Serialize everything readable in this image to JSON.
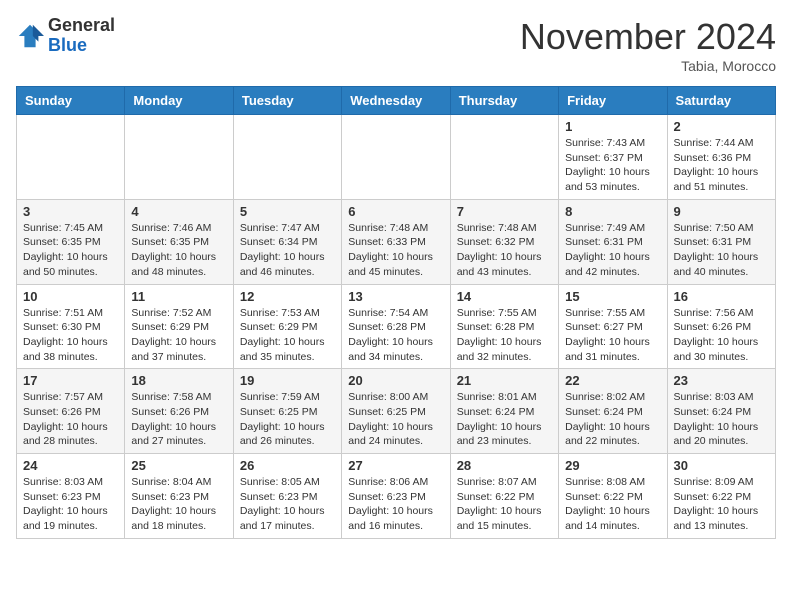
{
  "header": {
    "logo_general": "General",
    "logo_blue": "Blue",
    "month_title": "November 2024",
    "location": "Tabia, Morocco"
  },
  "weekdays": [
    "Sunday",
    "Monday",
    "Tuesday",
    "Wednesday",
    "Thursday",
    "Friday",
    "Saturday"
  ],
  "weeks": [
    [
      {
        "day": "",
        "info": ""
      },
      {
        "day": "",
        "info": ""
      },
      {
        "day": "",
        "info": ""
      },
      {
        "day": "",
        "info": ""
      },
      {
        "day": "",
        "info": ""
      },
      {
        "day": "1",
        "info": "Sunrise: 7:43 AM\nSunset: 6:37 PM\nDaylight: 10 hours and 53 minutes."
      },
      {
        "day": "2",
        "info": "Sunrise: 7:44 AM\nSunset: 6:36 PM\nDaylight: 10 hours and 51 minutes."
      }
    ],
    [
      {
        "day": "3",
        "info": "Sunrise: 7:45 AM\nSunset: 6:35 PM\nDaylight: 10 hours and 50 minutes."
      },
      {
        "day": "4",
        "info": "Sunrise: 7:46 AM\nSunset: 6:35 PM\nDaylight: 10 hours and 48 minutes."
      },
      {
        "day": "5",
        "info": "Sunrise: 7:47 AM\nSunset: 6:34 PM\nDaylight: 10 hours and 46 minutes."
      },
      {
        "day": "6",
        "info": "Sunrise: 7:48 AM\nSunset: 6:33 PM\nDaylight: 10 hours and 45 minutes."
      },
      {
        "day": "7",
        "info": "Sunrise: 7:48 AM\nSunset: 6:32 PM\nDaylight: 10 hours and 43 minutes."
      },
      {
        "day": "8",
        "info": "Sunrise: 7:49 AM\nSunset: 6:31 PM\nDaylight: 10 hours and 42 minutes."
      },
      {
        "day": "9",
        "info": "Sunrise: 7:50 AM\nSunset: 6:31 PM\nDaylight: 10 hours and 40 minutes."
      }
    ],
    [
      {
        "day": "10",
        "info": "Sunrise: 7:51 AM\nSunset: 6:30 PM\nDaylight: 10 hours and 38 minutes."
      },
      {
        "day": "11",
        "info": "Sunrise: 7:52 AM\nSunset: 6:29 PM\nDaylight: 10 hours and 37 minutes."
      },
      {
        "day": "12",
        "info": "Sunrise: 7:53 AM\nSunset: 6:29 PM\nDaylight: 10 hours and 35 minutes."
      },
      {
        "day": "13",
        "info": "Sunrise: 7:54 AM\nSunset: 6:28 PM\nDaylight: 10 hours and 34 minutes."
      },
      {
        "day": "14",
        "info": "Sunrise: 7:55 AM\nSunset: 6:28 PM\nDaylight: 10 hours and 32 minutes."
      },
      {
        "day": "15",
        "info": "Sunrise: 7:55 AM\nSunset: 6:27 PM\nDaylight: 10 hours and 31 minutes."
      },
      {
        "day": "16",
        "info": "Sunrise: 7:56 AM\nSunset: 6:26 PM\nDaylight: 10 hours and 30 minutes."
      }
    ],
    [
      {
        "day": "17",
        "info": "Sunrise: 7:57 AM\nSunset: 6:26 PM\nDaylight: 10 hours and 28 minutes."
      },
      {
        "day": "18",
        "info": "Sunrise: 7:58 AM\nSunset: 6:26 PM\nDaylight: 10 hours and 27 minutes."
      },
      {
        "day": "19",
        "info": "Sunrise: 7:59 AM\nSunset: 6:25 PM\nDaylight: 10 hours and 26 minutes."
      },
      {
        "day": "20",
        "info": "Sunrise: 8:00 AM\nSunset: 6:25 PM\nDaylight: 10 hours and 24 minutes."
      },
      {
        "day": "21",
        "info": "Sunrise: 8:01 AM\nSunset: 6:24 PM\nDaylight: 10 hours and 23 minutes."
      },
      {
        "day": "22",
        "info": "Sunrise: 8:02 AM\nSunset: 6:24 PM\nDaylight: 10 hours and 22 minutes."
      },
      {
        "day": "23",
        "info": "Sunrise: 8:03 AM\nSunset: 6:24 PM\nDaylight: 10 hours and 20 minutes."
      }
    ],
    [
      {
        "day": "24",
        "info": "Sunrise: 8:03 AM\nSunset: 6:23 PM\nDaylight: 10 hours and 19 minutes."
      },
      {
        "day": "25",
        "info": "Sunrise: 8:04 AM\nSunset: 6:23 PM\nDaylight: 10 hours and 18 minutes."
      },
      {
        "day": "26",
        "info": "Sunrise: 8:05 AM\nSunset: 6:23 PM\nDaylight: 10 hours and 17 minutes."
      },
      {
        "day": "27",
        "info": "Sunrise: 8:06 AM\nSunset: 6:23 PM\nDaylight: 10 hours and 16 minutes."
      },
      {
        "day": "28",
        "info": "Sunrise: 8:07 AM\nSunset: 6:22 PM\nDaylight: 10 hours and 15 minutes."
      },
      {
        "day": "29",
        "info": "Sunrise: 8:08 AM\nSunset: 6:22 PM\nDaylight: 10 hours and 14 minutes."
      },
      {
        "day": "30",
        "info": "Sunrise: 8:09 AM\nSunset: 6:22 PM\nDaylight: 10 hours and 13 minutes."
      }
    ]
  ]
}
